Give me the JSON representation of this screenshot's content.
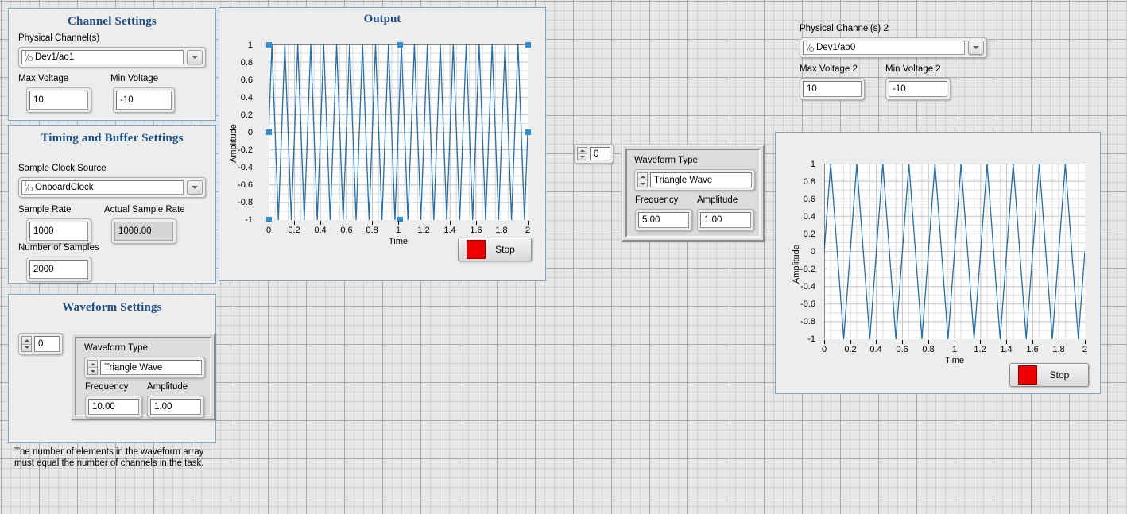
{
  "panels": {
    "channel_settings": {
      "title": "Channel Settings",
      "physical_channel_label": "Physical Channel(s)",
      "physical_channel_value": "Dev1/ao1",
      "max_voltage_label": "Max Voltage",
      "max_voltage_value": "10",
      "min_voltage_label": "Min Voltage",
      "min_voltage_value": "-10"
    },
    "timing_buffer": {
      "title": "Timing and Buffer Settings",
      "clock_source_label": "Sample Clock Source",
      "clock_source_value": "OnboardClock",
      "sample_rate_label": "Sample Rate",
      "sample_rate_value": "1000",
      "actual_sample_rate_label": "Actual Sample Rate",
      "actual_sample_rate_value": "1000.00",
      "number_of_samples_label": "Number of Samples",
      "number_of_samples_value": "2000"
    },
    "waveform_settings": {
      "title": "Waveform Settings",
      "index_value": "0",
      "waveform_type_label": "Waveform Type",
      "waveform_type_value": "Triangle Wave",
      "frequency_label": "Frequency",
      "frequency_value": "10.00",
      "amplitude_label": "Amplitude",
      "amplitude_value": "1.00",
      "note": "The number of elements in the waveform array\nmust equal the number of channels in the task."
    },
    "channel_settings_2": {
      "physical_channel_label": "Physical Channel(s) 2",
      "physical_channel_value": "Dev1/ao0",
      "max_voltage_label": "Max Voltage 2",
      "max_voltage_value": "10",
      "min_voltage_label": "Min Voltage 2",
      "min_voltage_value": "-10"
    },
    "waveform_settings_2": {
      "index_value": "0",
      "waveform_type_label": "Waveform Type",
      "waveform_type_value": "Triangle Wave",
      "frequency_label": "Frequency",
      "frequency_value": "5.00",
      "amplitude_label": "Amplitude",
      "amplitude_value": "1.00"
    }
  },
  "buttons": {
    "stop_label": "Stop",
    "stop_label_2": "Stop"
  },
  "colors": {
    "panel_border": "#7ba7cf",
    "title_text": "#1a4f8a",
    "plot_trace": "#1f6fb4",
    "stop_led": "#ef0000",
    "selection_handle": "#2a8fd8"
  },
  "chart_data": [
    {
      "id": "output-graph",
      "type": "line",
      "title": "Output",
      "xlabel": "Time",
      "ylabel": "Amplitude",
      "xlim": [
        0,
        2
      ],
      "ylim": [
        -1,
        1
      ],
      "xticks": [
        "0",
        "0.2",
        "0.4",
        "0.6",
        "0.8",
        "1",
        "1.2",
        "1.4",
        "1.6",
        "1.8",
        "2"
      ],
      "yticks": [
        "1",
        "0.8",
        "0.6",
        "0.4",
        "0.2",
        "0",
        "-0.2",
        "-0.4",
        "-0.6",
        "-0.8",
        "-1"
      ],
      "grid": true,
      "legend": "none",
      "series": [
        {
          "name": "Triangle Wave",
          "waveform": "triangle",
          "frequency_hz": 10.0,
          "amplitude": 1.0,
          "duration_s": 2.0,
          "cycles": 20,
          "color": "#1f6fb4"
        }
      ]
    },
    {
      "id": "output-graph-2",
      "type": "line",
      "title": "",
      "xlabel": "Time",
      "ylabel": "Amplitude",
      "xlim": [
        0,
        2
      ],
      "ylim": [
        -1,
        1
      ],
      "xticks": [
        "0",
        "0.2",
        "0.4",
        "0.6",
        "0.8",
        "1",
        "1.2",
        "1.4",
        "1.6",
        "1.8",
        "2"
      ],
      "yticks": [
        "1",
        "0.8",
        "0.6",
        "0.4",
        "0.2",
        "0",
        "-0.2",
        "-0.4",
        "-0.6",
        "-0.8",
        "-1"
      ],
      "grid": true,
      "legend": "none",
      "series": [
        {
          "name": "Triangle Wave",
          "waveform": "triangle",
          "frequency_hz": 5.0,
          "amplitude": 1.0,
          "duration_s": 2.0,
          "cycles": 10,
          "color": "#1f6fb4"
        }
      ]
    }
  ]
}
